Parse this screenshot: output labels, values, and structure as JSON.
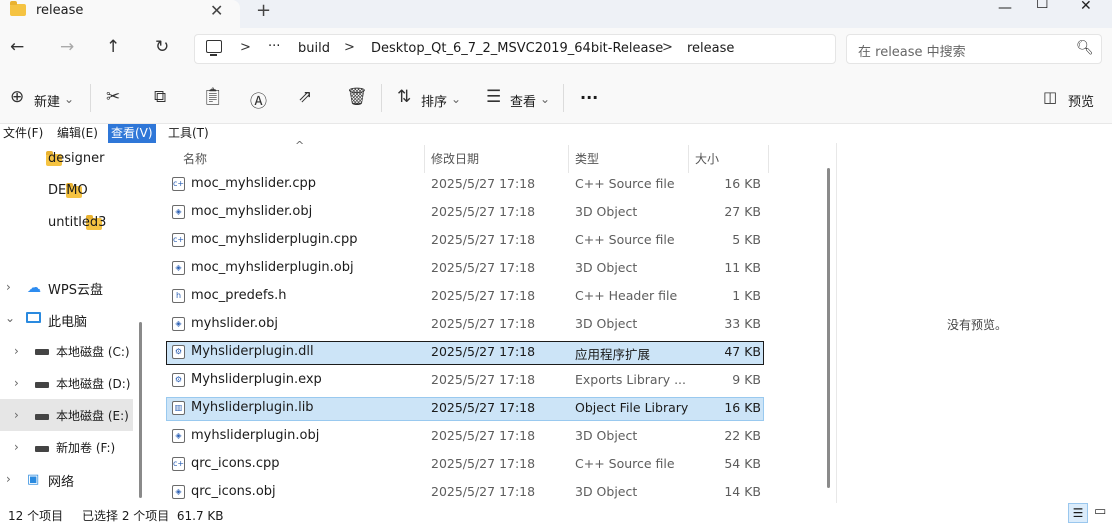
{
  "tab": {
    "title": "release",
    "close": "✕",
    "new": "+"
  },
  "window": {
    "minimize": "—",
    "maximize": "☐",
    "close": "✕"
  },
  "nav": {
    "back": "←",
    "forward": "→",
    "up": "↑",
    "refresh": "↻"
  },
  "address": {
    "more": "···",
    "sep": ">",
    "crumbs": [
      "build",
      "Desktop_Qt_6_7_2_MSVC2019_64bit-Release",
      "release"
    ]
  },
  "search": {
    "placeholder": "在 release 中搜索"
  },
  "commands": {
    "new_label": "新建",
    "sort_label": "排序",
    "view_label": "查看",
    "more": "···",
    "preview_label": "预览"
  },
  "menu": [
    "文件(F)",
    "编辑(E)",
    "查看(V)",
    "工具(T)"
  ],
  "sidebar": {
    "folders": [
      "designer",
      "DEMO",
      "untitled3"
    ],
    "wps": "WPS云盘",
    "pc": "此电脑",
    "drives": [
      "本地磁盘 (C:)",
      "本地磁盘 (D:)",
      "本地磁盘 (E:)",
      "新加卷 (F:)"
    ],
    "network": "网络"
  },
  "columns": {
    "name": "名称",
    "date": "修改日期",
    "type": "类型",
    "size": "大小"
  },
  "files": [
    {
      "name": "moc_myhslider.cpp",
      "date": "2025/5/27 17:18",
      "type": "C++ Source file",
      "size": "16 KB",
      "icon": "cpp-file-icon",
      "glyph": "c+"
    },
    {
      "name": "moc_myhslider.obj",
      "date": "2025/5/27 17:18",
      "type": "3D Object",
      "size": "27 KB",
      "icon": "obj-file-icon",
      "glyph": "◈"
    },
    {
      "name": "moc_myhsliderplugin.cpp",
      "date": "2025/5/27 17:18",
      "type": "C++ Source file",
      "size": "5 KB",
      "icon": "cpp-file-icon",
      "glyph": "c+"
    },
    {
      "name": "moc_myhsliderplugin.obj",
      "date": "2025/5/27 17:18",
      "type": "3D Object",
      "size": "11 KB",
      "icon": "obj-file-icon",
      "glyph": "◈"
    },
    {
      "name": "moc_predefs.h",
      "date": "2025/5/27 17:18",
      "type": "C++ Header file",
      "size": "1 KB",
      "icon": "header-file-icon",
      "glyph": "h"
    },
    {
      "name": "myhslider.obj",
      "date": "2025/5/27 17:18",
      "type": "3D Object",
      "size": "33 KB",
      "icon": "obj-file-icon",
      "glyph": "◈"
    },
    {
      "name": "Myhsliderplugin.dll",
      "date": "2025/5/27 17:18",
      "type": "应用程序扩展",
      "size": "47 KB",
      "icon": "dll-file-icon",
      "glyph": "⚙"
    },
    {
      "name": "Myhsliderplugin.exp",
      "date": "2025/5/27 17:18",
      "type": "Exports Library ...",
      "size": "9 KB",
      "icon": "exp-file-icon",
      "glyph": "⚙"
    },
    {
      "name": "Myhsliderplugin.lib",
      "date": "2025/5/27 17:18",
      "type": "Object File Library",
      "size": "16 KB",
      "icon": "lib-file-icon",
      "glyph": "▥"
    },
    {
      "name": "myhsliderplugin.obj",
      "date": "2025/5/27 17:18",
      "type": "3D Object",
      "size": "22 KB",
      "icon": "obj-file-icon",
      "glyph": "◈"
    },
    {
      "name": "qrc_icons.cpp",
      "date": "2025/5/27 17:18",
      "type": "C++ Source file",
      "size": "54 KB",
      "icon": "cpp-file-icon",
      "glyph": "c+"
    },
    {
      "name": "qrc_icons.obj",
      "date": "2025/5/27 17:18",
      "type": "3D Object",
      "size": "14 KB",
      "icon": "obj-file-icon",
      "glyph": "◈"
    }
  ],
  "preview": {
    "empty": "没有预览。"
  },
  "status": {
    "count": "12 个项目",
    "selected": "已选择 2 个项目  61.7 KB"
  },
  "colors": {
    "accent": "#2f77d8",
    "selection": "#cce4f7",
    "folder": "#f5c342"
  }
}
